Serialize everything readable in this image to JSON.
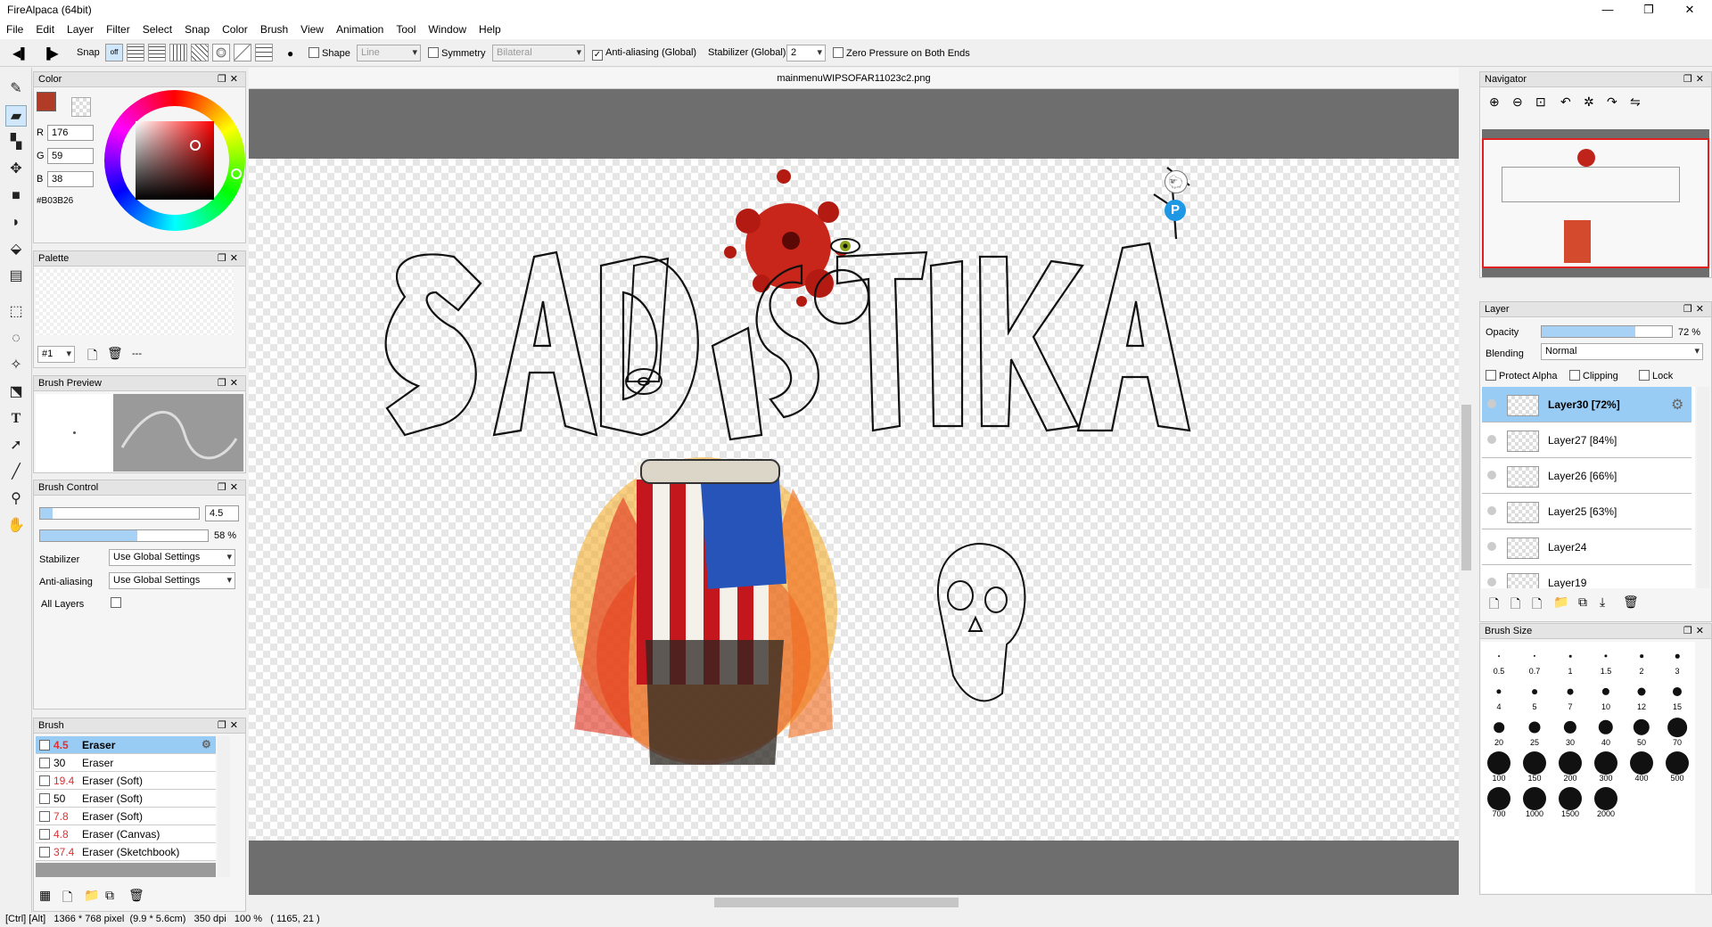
{
  "window": {
    "title": "FireAlpaca (64bit)",
    "minimize": "—",
    "maximize": "❐",
    "close": "✕"
  },
  "menu": [
    "File",
    "Edit",
    "Layer",
    "Filter",
    "Select",
    "Snap",
    "Color",
    "Brush",
    "View",
    "Animation",
    "Tool",
    "Window",
    "Help"
  ],
  "toolbar": {
    "snap_label": "Snap",
    "snap_off_label": "off",
    "shape_label": "Shape",
    "shape_value": "Line",
    "symmetry_label": "Symmetry",
    "symmetry_value": "Bilateral",
    "antialias_label": "Anti-aliasing (Global)",
    "stabilizer_label": "Stabilizer (Global)",
    "stabilizer_value": "2",
    "zero_pressure_label": "Zero Pressure on Both Ends"
  },
  "color_panel": {
    "title": "Color",
    "r_label": "R",
    "r": "176",
    "g_label": "G",
    "g": "59",
    "b_label": "B",
    "b": "38",
    "hex": "#B03B26",
    "fg_color": "#B03B26"
  },
  "palette_panel": {
    "title": "Palette",
    "selector": "#1",
    "dash": "---"
  },
  "brush_preview_panel": {
    "title": "Brush Preview"
  },
  "brush_control_panel": {
    "title": "Brush Control",
    "size": "4.5",
    "opacity": "58 %",
    "opacity_fraction": 0.58,
    "stabilizer_label": "Stabilizer",
    "stabilizer_value": "Use Global Settings",
    "antialias_label": "Anti-aliasing",
    "antialias_value": "Use Global Settings",
    "all_layers_label": "All Layers"
  },
  "brush_panel": {
    "title": "Brush",
    "items": [
      {
        "size": "4.5",
        "name": "Eraser",
        "selected": true
      },
      {
        "size": "30",
        "name": "Eraser",
        "selected": false
      },
      {
        "size": "19.4",
        "name": "Eraser (Soft)",
        "selected": false
      },
      {
        "size": "50",
        "name": "Eraser (Soft)",
        "selected": false
      },
      {
        "size": "7.8",
        "name": "Eraser (Soft)",
        "selected": false
      },
      {
        "size": "4.8",
        "name": "Eraser (Canvas)",
        "selected": false
      },
      {
        "size": "37.4",
        "name": "Eraser (Sketchbook)",
        "selected": false
      }
    ]
  },
  "canvas": {
    "tab": "mainmenuWIPSOFAR11023c2.png"
  },
  "navigator_panel": {
    "title": "Navigator"
  },
  "layer_panel": {
    "title": "Layer",
    "opacity_label": "Opacity",
    "opacity_value": "72 %",
    "opacity_fraction": 0.72,
    "blending_label": "Blending",
    "blending_value": "Normal",
    "protect_alpha_label": "Protect Alpha",
    "clipping_label": "Clipping",
    "lock_label": "Lock",
    "layers": [
      {
        "name": "Layer30 [72%]",
        "selected": true
      },
      {
        "name": "Layer27 [84%]",
        "selected": false
      },
      {
        "name": "Layer26 [66%]",
        "selected": false
      },
      {
        "name": "Layer25 [63%]",
        "selected": false
      },
      {
        "name": "Layer24",
        "selected": false
      },
      {
        "name": "Layer19",
        "selected": false
      }
    ]
  },
  "brush_size_panel": {
    "title": "Brush Size",
    "sizes": [
      "0.5",
      "0.7",
      "1",
      "1.5",
      "2",
      "3",
      "4",
      "5",
      "7",
      "10",
      "12",
      "15",
      "20",
      "25",
      "30",
      "40",
      "50",
      "70",
      "100",
      "150",
      "200",
      "300",
      "400",
      "500",
      "700",
      "1000",
      "1500",
      "2000"
    ]
  },
  "status": {
    "keys": "[Ctrl] [Alt]",
    "pixels": "1366 * 768 pixel",
    "size_cm": "(9.9 * 5.6cm)",
    "dpi": "350 dpi",
    "zoom": "100 %",
    "cursor": "( 1165, 21 )"
  }
}
